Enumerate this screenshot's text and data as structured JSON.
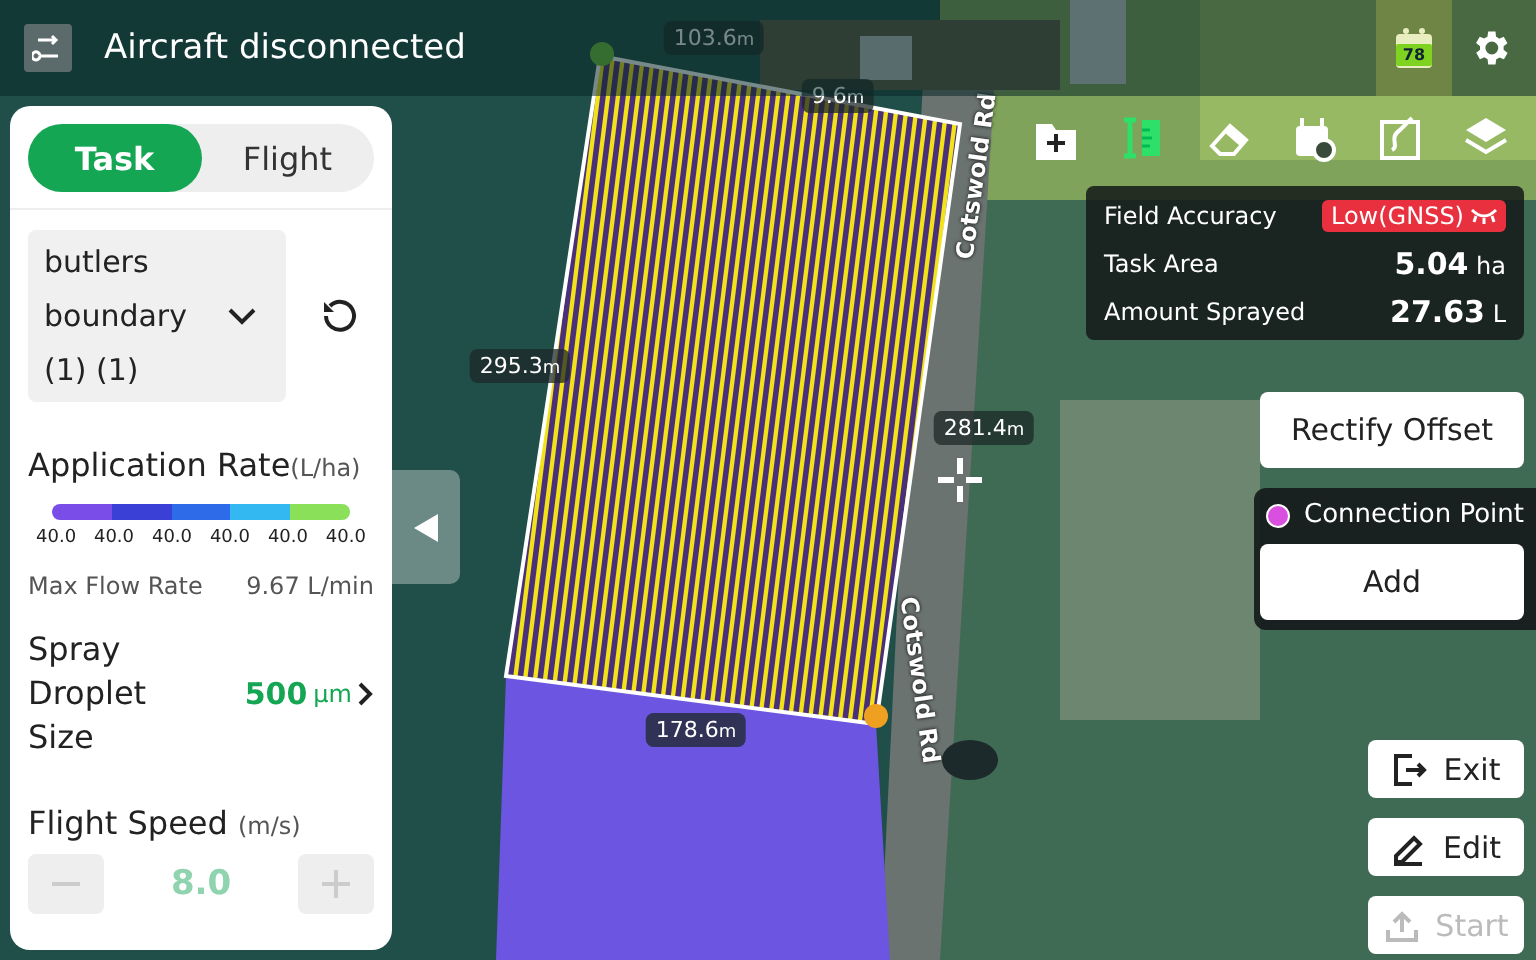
{
  "header": {
    "title": "Aircraft disconnected",
    "battery": "78"
  },
  "panel": {
    "tabs": [
      {
        "label": "Task",
        "selected": true
      },
      {
        "label": "Flight",
        "selected": false
      }
    ],
    "task_name": "butlers boundary (1)  (1)",
    "application_rate": {
      "label": "Application Rate",
      "unit": "(L/ha)",
      "segments": [
        {
          "color": "#7b4de8"
        },
        {
          "color": "#3a3fd6"
        },
        {
          "color": "#2d6be8"
        },
        {
          "color": "#33b8f2"
        },
        {
          "color": "#8be05a"
        }
      ],
      "ticks": [
        "40.0",
        "40.0",
        "40.0",
        "40.0",
        "40.0",
        "40.0"
      ]
    },
    "max_flow_rate": {
      "label": "Max Flow Rate",
      "value": "9.67",
      "unit": "L/min"
    },
    "droplet_size": {
      "label": "Spray Droplet Size",
      "value": "500",
      "unit": "µm"
    },
    "flight_speed": {
      "label": "Flight Speed",
      "unit": "(m/s)",
      "value": "8.0"
    }
  },
  "info": {
    "rows": [
      {
        "kind": "badge",
        "label": "Field Accuracy",
        "value": "Low(GNSS)"
      },
      {
        "kind": "value",
        "label": "Task Area",
        "value": "5.04",
        "unit": "ha"
      },
      {
        "kind": "value",
        "label": "Amount Sprayed",
        "value": "27.63",
        "unit": "L"
      }
    ]
  },
  "rectify_button": "Rectify Offset",
  "connection_point": {
    "label": "Connection Point",
    "color": "#d94fe0",
    "button": "Add"
  },
  "actions": [
    {
      "kind": "exit",
      "label": "Exit",
      "disabled": false
    },
    {
      "kind": "edit",
      "label": "Edit",
      "disabled": false
    },
    {
      "kind": "start",
      "label": "Start",
      "disabled": true
    }
  ],
  "map": {
    "distances": [
      {
        "value": "103.6",
        "unit": "m"
      },
      {
        "value": "9.6",
        "unit": "m"
      },
      {
        "value": "295.3",
        "unit": "m"
      },
      {
        "value": "281.4",
        "unit": "m"
      },
      {
        "value": "178.6",
        "unit": "m"
      }
    ],
    "roads": [
      "Cotswold Rd",
      "Cotswold Rd"
    ]
  }
}
